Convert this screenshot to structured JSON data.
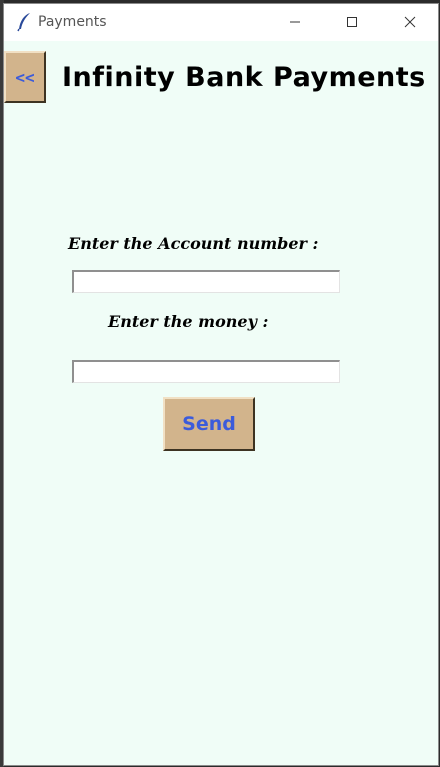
{
  "window": {
    "title": "Payments",
    "app_icon": "feather-icon",
    "controls": {
      "minimize_icon": "minimize-icon",
      "maximize_icon": "maximize-icon",
      "close_icon": "close-icon"
    }
  },
  "header": {
    "back_label": "<<",
    "title": "Infinity Bank Payments"
  },
  "form": {
    "account_label": "Enter the Account number :",
    "account_value": "",
    "money_label": "Enter the money :",
    "money_value": "",
    "send_label": "Send"
  },
  "colors": {
    "background": "#f0fdf7",
    "button_bg": "#d2b48c",
    "button_text": "#3b5bdb",
    "titlebar": "#ffffff"
  }
}
